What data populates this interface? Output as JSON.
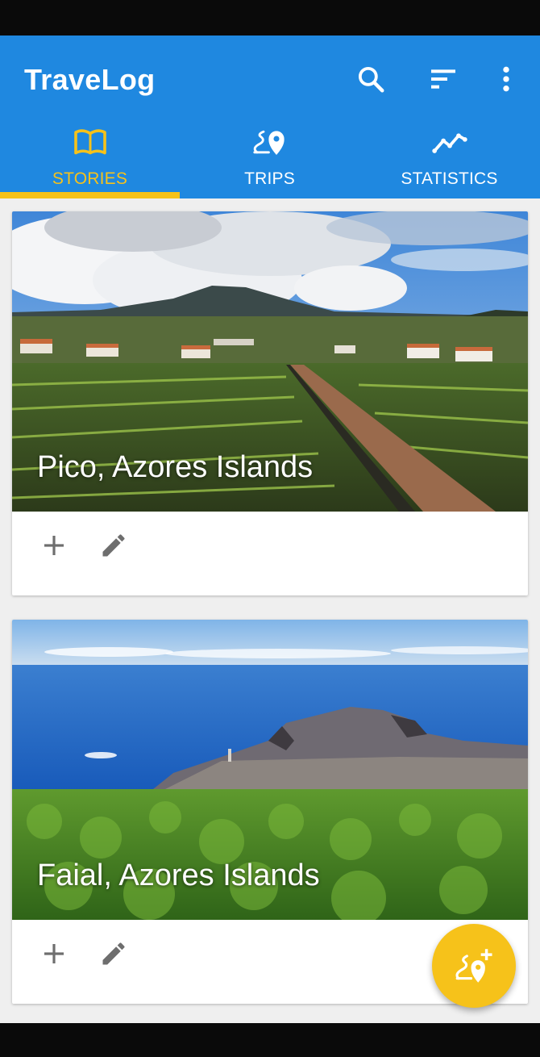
{
  "app": {
    "title": "TraveLog"
  },
  "toolbar": {
    "icons": [
      "search-icon",
      "sort-icon",
      "more-vertical-icon"
    ]
  },
  "tabs": [
    {
      "label": "STORIES",
      "icon": "book-open-icon",
      "active": true
    },
    {
      "label": "TRIPS",
      "icon": "route-pin-icon",
      "active": false
    },
    {
      "label": "STATISTICS",
      "icon": "trend-line-icon",
      "active": false
    }
  ],
  "stories": [
    {
      "title": "Pico, Azores Islands",
      "actions": [
        "add-icon",
        "edit-icon"
      ]
    },
    {
      "title": "Faial, Azores Islands",
      "actions": [
        "add-icon",
        "edit-icon"
      ]
    }
  ],
  "fab": {
    "icon": "add-trip-icon"
  },
  "colors": {
    "primary": "#1f88e0",
    "accent": "#f6c21a",
    "background": "#efefef",
    "icon_grey": "#6e6e6e"
  }
}
